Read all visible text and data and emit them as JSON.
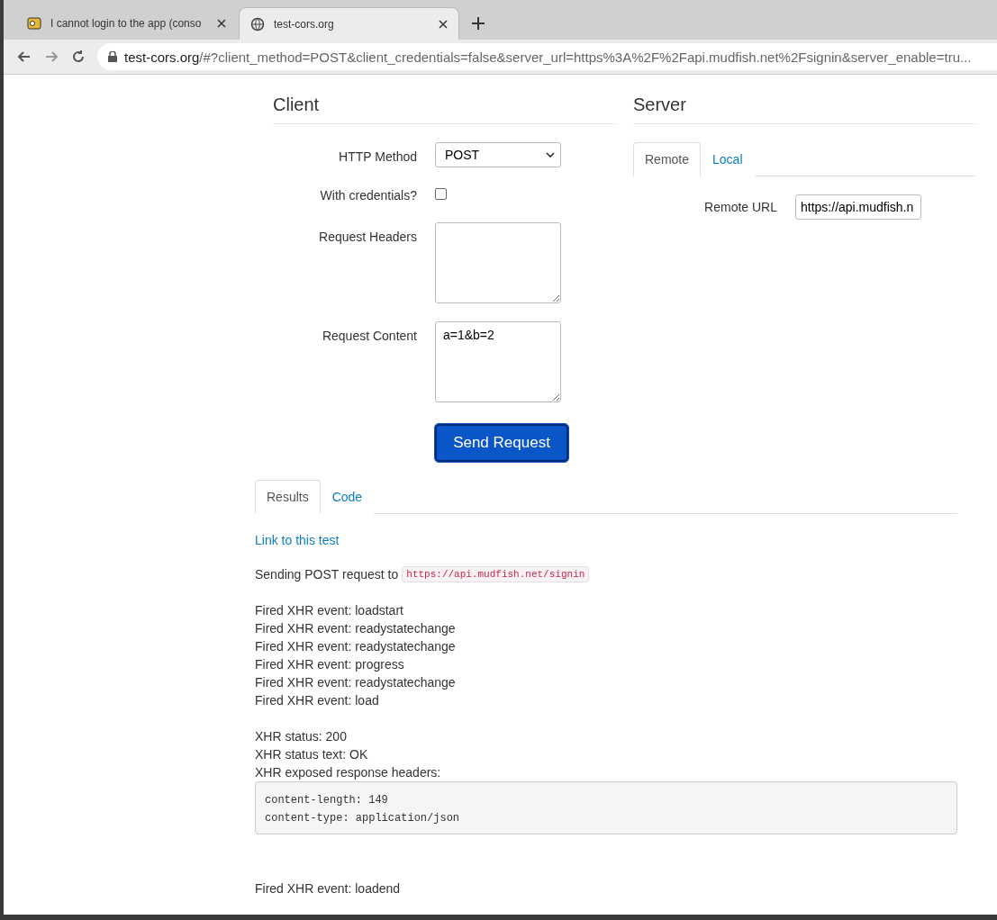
{
  "browser": {
    "tabs": [
      {
        "title": "I cannot login to the app (conso",
        "selected": false
      },
      {
        "title": "test-cors.org",
        "selected": true
      }
    ],
    "address": {
      "host": "test-cors.org",
      "path": "/#?client_method=POST&client_credentials=false&server_url=https%3A%2F%2Fapi.mudfish.net%2Fsignin&server_enable=tru..."
    }
  },
  "client": {
    "title": "Client",
    "method": {
      "label": "HTTP Method",
      "value": "POST"
    },
    "credentials": {
      "label": "With credentials?",
      "checked": false
    },
    "headers": {
      "label": "Request Headers"
    },
    "content": {
      "label": "Request Content",
      "value": "a=1&b=2"
    },
    "send_button": "Send Request"
  },
  "server": {
    "title": "Server",
    "tabs": [
      {
        "label": "Remote",
        "selected": true
      },
      {
        "label": "Local",
        "selected": false
      }
    ],
    "remote_url": {
      "label": "Remote URL",
      "value": "https://api.mudfish.n"
    }
  },
  "results": {
    "tabs": [
      {
        "label": "Results",
        "selected": true
      },
      {
        "label": "Code",
        "selected": false
      }
    ],
    "link": "Link to this test",
    "sending": {
      "text": "Sending POST request to",
      "url": "https://api.mudfish.net/signin"
    },
    "events": [
      "Fired XHR event: loadstart",
      "Fired XHR event: readystatechange",
      "Fired XHR event: readystatechange",
      "Fired XHR event: progress",
      "Fired XHR event: readystatechange",
      "Fired XHR event: load"
    ],
    "status": [
      "XHR status: 200",
      "XHR status text: OK",
      "XHR exposed response headers:"
    ],
    "headers_block": [
      "content-length: 149",
      "content-type: application/json"
    ],
    "final_event": "Fired XHR event: loadend"
  }
}
